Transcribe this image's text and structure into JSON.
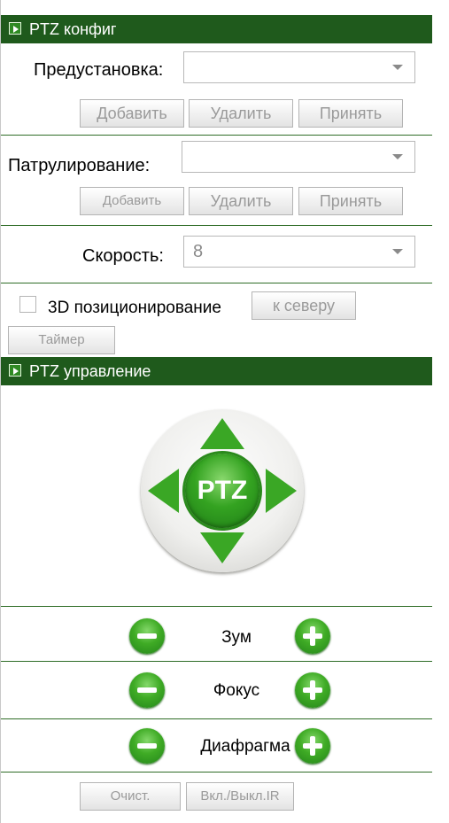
{
  "config": {
    "title": "PTZ конфиг",
    "preset": {
      "label": "Предустановка:",
      "value": "",
      "buttons": [
        "Добавить",
        "Удалить",
        "Принять"
      ]
    },
    "patrol": {
      "label": "Патрулирование:",
      "value": "",
      "buttons": [
        "Добавить",
        "Удалить",
        "Принять"
      ]
    },
    "speed": {
      "label": "Скорость:",
      "value": "8"
    },
    "positioning_3d": {
      "label": "3D позиционирование",
      "checked": false
    },
    "north_button": "к северу",
    "timer_button": "Таймер"
  },
  "control": {
    "title": "PTZ управление",
    "center_label": "PTZ",
    "zoom_label": "Зум",
    "focus_label": "Фокус",
    "iris_label": "Диафрагма",
    "clear_button": "Очист.",
    "ir_button": "Вкл./Выкл.IR"
  }
}
